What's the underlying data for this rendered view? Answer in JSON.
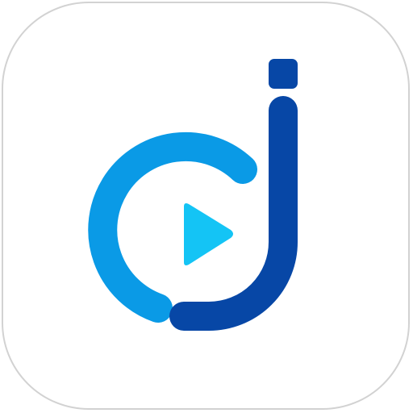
{
  "app_icon": {
    "icon": "dj-play-logo-icon",
    "colors": {
      "tile_background": "#ffffff",
      "tile_border": "#d2d2d2",
      "ring": "#0a9ae6",
      "play": "#14c4f5",
      "letter_j": "#0747a6"
    }
  }
}
